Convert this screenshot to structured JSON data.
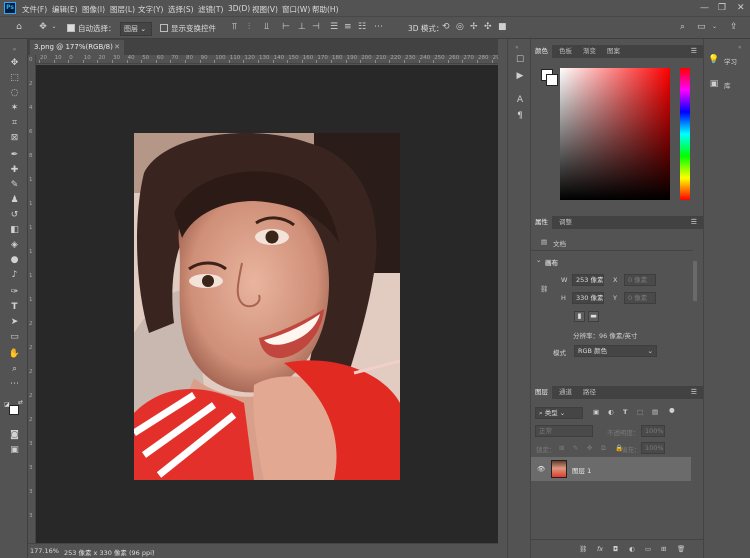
{
  "app": {
    "logo_text": "Ps"
  },
  "menu": [
    "文件(F)",
    "编辑(E)",
    "图像(I)",
    "图层(L)",
    "文字(Y)",
    "选择(S)",
    "滤镜(T)",
    "3D(D)",
    "视图(V)",
    "窗口(W)",
    "帮助(H)"
  ],
  "window_controls": {
    "minimize": "—",
    "restore": "❐",
    "close": "✕"
  },
  "options": {
    "auto_select_label": "自动选择：",
    "auto_select_target": "图层",
    "show_transform_label": "显示变换控件",
    "mode_3d_label": "3D 模式："
  },
  "document": {
    "tab_title": "3.png @ 177%(RGB/8)",
    "close_glyph": "✕"
  },
  "ruler_h": [
    "20",
    "10",
    "0",
    "10",
    "20",
    "30",
    "40",
    "50",
    "60",
    "70",
    "80",
    "90",
    "100",
    "110",
    "120",
    "130",
    "140",
    "150",
    "160",
    "170",
    "180",
    "190",
    "200",
    "210",
    "220",
    "230",
    "240",
    "250",
    "260",
    "270",
    "280",
    "290"
  ],
  "ruler_v": [
    "0",
    "2",
    "4",
    "6",
    "8",
    "1",
    "1",
    "1",
    "1",
    "1",
    "1",
    "2",
    "2",
    "2",
    "2",
    "2",
    "3",
    "3",
    "3",
    "3"
  ],
  "status": {
    "zoom": "177.16%",
    "doc_info": "253 像素 x 330 像素 (96 ppi)"
  },
  "color_panel": {
    "tabs": [
      "颜色",
      "色板",
      "渐变",
      "图案"
    ],
    "fg": "#ffffff",
    "bg": "#ffffff",
    "hue": "#ff0000"
  },
  "properties_panel": {
    "tabs": [
      "属性",
      "调整"
    ],
    "doc_label": "文档",
    "canvas_section": "画布",
    "w_label": "W",
    "w_value": "253 像素",
    "x_label": "X",
    "x_value": "0 像素",
    "h_label": "H",
    "h_value": "330 像素",
    "y_label": "Y",
    "y_value": "0 像素",
    "resolution": "分辨率：96 像素/英寸",
    "mode_label": "模式",
    "mode_value": "RGB 颜色"
  },
  "layers_panel": {
    "tabs": [
      "图层",
      "通道",
      "路径"
    ],
    "filter_kind": "类型",
    "blend_mode": "正常",
    "opacity_label": "不透明度：",
    "opacity_value": "100%",
    "lock_label": "锁定：",
    "fill_label": "填充：",
    "fill_value": "100%",
    "layer_name": "图层 1"
  },
  "right_dock": {
    "learn": "学习",
    "library": "库"
  }
}
